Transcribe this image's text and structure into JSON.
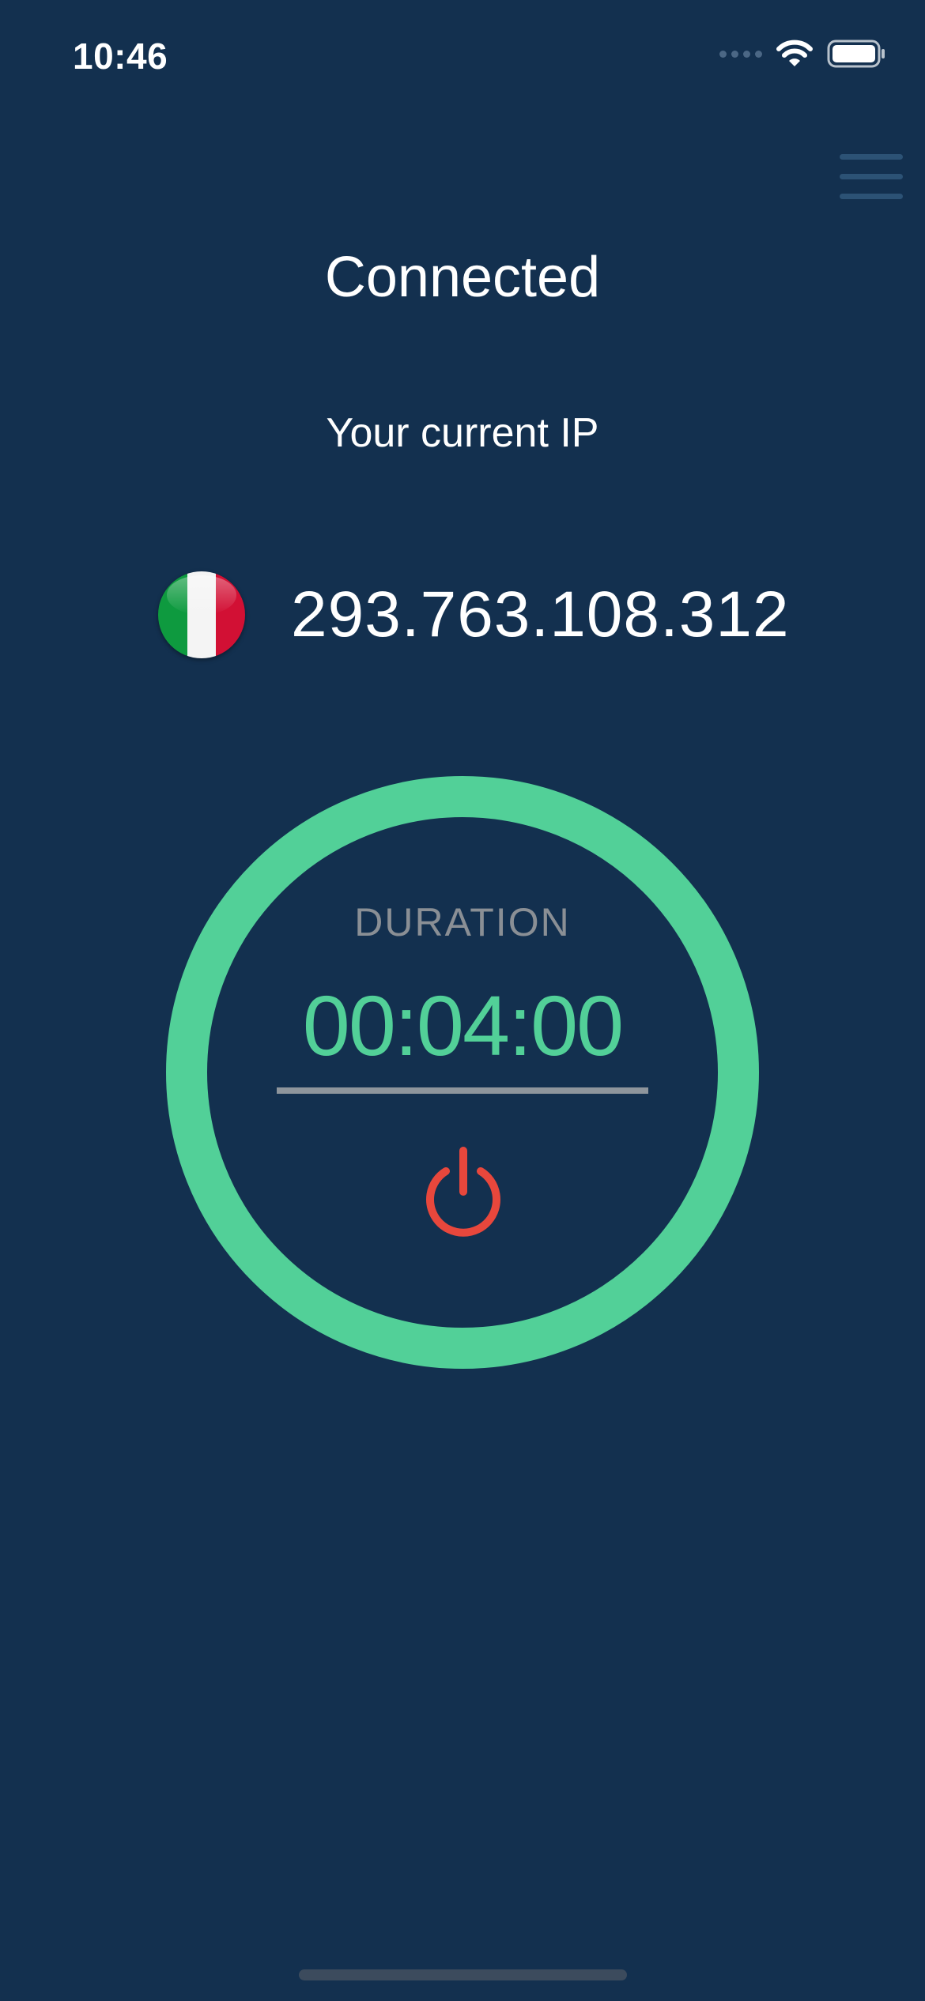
{
  "status_bar": {
    "time": "10:46",
    "icons": [
      "cellular-signal-icon",
      "wifi-icon",
      "battery-icon"
    ]
  },
  "header": {
    "menu_icon": "hamburger-menu-icon"
  },
  "connection": {
    "status": "Connected",
    "ip_label": "Your current IP",
    "ip_address": "293.763.108.312",
    "country_flag_icon": "italy-flag-icon",
    "flag_colors": [
      "#0e9a3f",
      "#f4f4f4",
      "#d21034"
    ]
  },
  "timer": {
    "label": "DURATION",
    "value": "00:04:00",
    "ring_color": "#52d098"
  },
  "power": {
    "icon": "power-icon",
    "color": "#e8473c"
  },
  "colors": {
    "background": "#13304f",
    "accent": "#52d098",
    "danger": "#e8473c"
  }
}
